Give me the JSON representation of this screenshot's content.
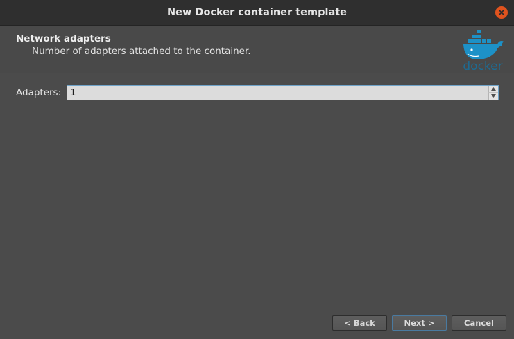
{
  "window": {
    "title": "New Docker container template"
  },
  "header": {
    "title": "Network adapters",
    "subtitle": "Number of adapters attached to the container.",
    "logo_text": "docker"
  },
  "form": {
    "adapters_label": "Adapters:",
    "adapters_value": "1"
  },
  "buttons": {
    "back_prefix": "< ",
    "back_mnemonic": "B",
    "back_rest": "ack",
    "next_mnemonic": "N",
    "next_rest": "ext >",
    "cancel": "Cancel"
  },
  "colors": {
    "close_button": "#e0531e",
    "docker_blue": "#1d91c7",
    "focus_border": "#6fa3c9"
  }
}
